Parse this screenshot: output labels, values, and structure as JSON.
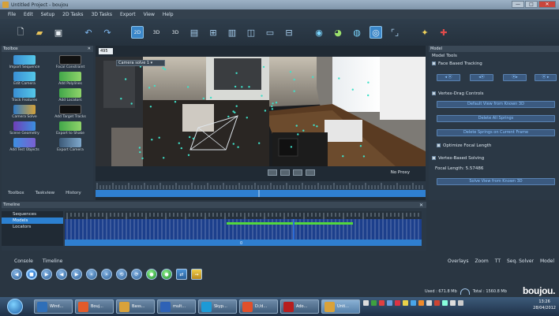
{
  "window": {
    "title": "Untitled Project - boujou",
    "buttons": [
      "—",
      "□",
      "✕"
    ]
  },
  "menu": [
    "File",
    "Edit",
    "Setup",
    "2D Tasks",
    "3D Tasks",
    "Export",
    "View",
    "Help"
  ],
  "toolbar": {
    "icons": [
      "new-file-icon",
      "open-folder-icon",
      "save-icon",
      "undo-icon",
      "redo-icon",
      "view-2d-icon",
      "view-3d-icon",
      "view-3d-alt-icon",
      "image-icon",
      "grid-icon",
      "layout-icon",
      "layout-split-icon",
      "layout-wide-icon",
      "layout-tiles-icon",
      "planet-icon",
      "globe-icon",
      "globe-alt-icon",
      "camera-selected-icon",
      "brackets-icon",
      "target-icon",
      "marker-icon"
    ]
  },
  "toolbox": {
    "title": "Toolbox",
    "tools": [
      {
        "label": "Import Sequence"
      },
      {
        "label": "Focal Constraint"
      },
      {
        "label": "Edit Camera"
      },
      {
        "label": "Add Polylines"
      },
      {
        "label": "Track Features"
      },
      {
        "label": "Add Locators"
      },
      {
        "label": "Camera Solve"
      },
      {
        "label": "Add Target Tracks"
      },
      {
        "label": "Scene Geometry"
      },
      {
        "label": "Export to Shake"
      },
      {
        "label": "Add Test Objects"
      },
      {
        "label": "Export Camera"
      }
    ],
    "tabs": [
      "Toolbox",
      "Taskview",
      "History"
    ]
  },
  "viewport": {
    "frame": "495",
    "camera_select": "Camera solve 1",
    "no_proxy": "No Proxy",
    "scrub_marker": "0"
  },
  "model": {
    "title": "Model",
    "tools_heading": "Model Tools",
    "face_tracking": "Face Based Tracking",
    "vertex_drag": "Vertex-Drag Controls",
    "btn_default_view": "Default View from Known 3D",
    "btn_delete_springs": "Delete All Springs",
    "btn_delete_springs_frame": "Delete Springs on Current Frame",
    "optimize": "Optimize Focal Length",
    "vertex_solving": "Vertex-Based Solving",
    "focal_label": "Focal Length:",
    "focal_value": "5.57486",
    "btn_solve": "Solve View from Known 3D"
  },
  "timeline": {
    "title": "Timeline",
    "items": [
      "Sequences",
      "Models",
      "Locators"
    ],
    "marker": "0"
  },
  "bottom_tabs_left": [
    "Console",
    "Timeline"
  ],
  "bottom_tabs_right": [
    "Overlays",
    "Zoom",
    "TT",
    "Seq. Solver",
    "Model"
  ],
  "memory": {
    "used": "Used : 671.8 Mb",
    "total": "Total : 1560.8 Mb"
  },
  "brand": "boujou.",
  "taskbar": {
    "items": [
      {
        "label": "Wind...",
        "color": "#2f6fb8"
      },
      {
        "label": "Bouj...",
        "color": "#e35b2a"
      },
      {
        "label": "Bass...",
        "color": "#d9a23a"
      },
      {
        "label": "mult...",
        "color": "#2e62b6"
      },
      {
        "label": "Skyp...",
        "color": "#1d9ad6"
      },
      {
        "label": "D:/d...",
        "color": "#e0502b"
      },
      {
        "label": "Ado...",
        "color": "#b71e1e"
      },
      {
        "label": "Unti...",
        "color": "#d9a23a"
      }
    ],
    "time": "13:26",
    "date": "28/04/2012"
  }
}
